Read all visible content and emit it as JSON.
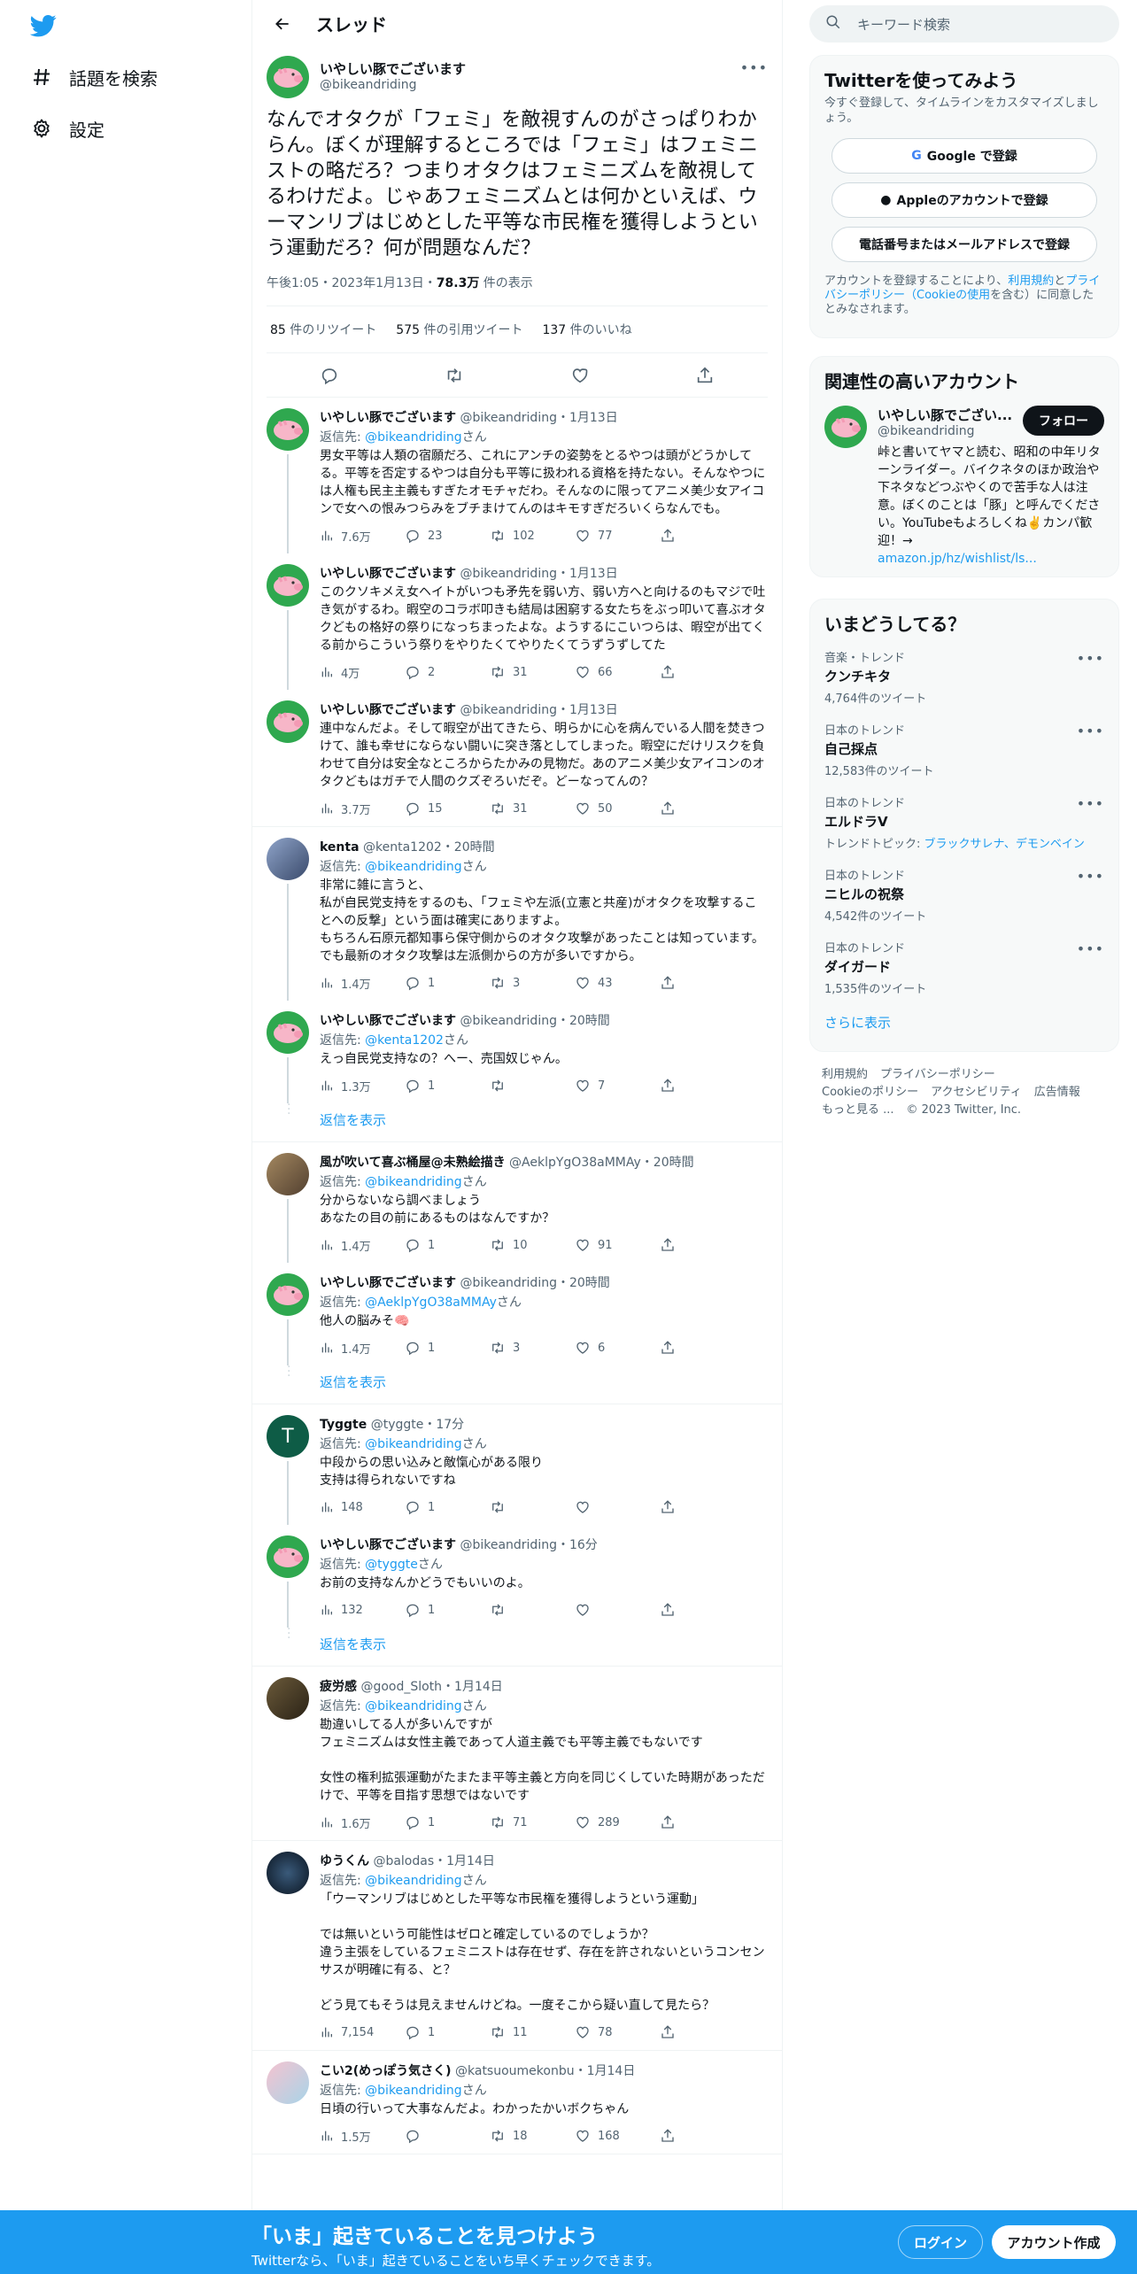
{
  "nav": {
    "explore": "話題を検索",
    "settings": "設定"
  },
  "header": {
    "title": "スレッド"
  },
  "main_tweet": {
    "name": "いやしい豚でございます",
    "handle": "@bikeandriding",
    "text": "なんでオタクが「フェミ」を敵視すんのがさっぱりわからん。ぼくが理解するところでは「フェミ」はフェミニストの略だろ？つまりオタクはフェミニズムを敵視してるわけだよ。じゃあフェミニズムとは何かといえば、ウーマンリブはじめとした平等な市民権を獲得しようという運動だろ？何が問題なんだ？",
    "time": "午後1:05・2023年1月13日・",
    "views": "78.3万",
    "views_label": " 件の表示",
    "retweets": "85",
    "retweets_label": " 件のリツイート",
    "quotes": "575",
    "quotes_label": " 件の引用ツイート",
    "likes": "137",
    "likes_label": " 件のいいね"
  },
  "replies": [
    {
      "name": "いやしい豚でございます",
      "handle": "@bikeandriding",
      "time": "・1月13日",
      "reply_to": "@bikeandriding",
      "text": "男女平等は人類の宿願だろ、これにアンチの姿勢をとるやつは頭がどうかしてる。平等を否定するやつは自分も平等に扱われる資格を持たない。そんなやつには人権も民主主義もすぎたオモチャだわ。そんなのに限ってアニメ美少女アイコンで女への恨みつらみをブチまけてんのはキモすぎだろいくらなんでも。",
      "views": "7.6万",
      "replies": "23",
      "rts": "102",
      "likes": "77"
    },
    {
      "name": "いやしい豚でございます",
      "handle": "@bikeandriding",
      "time": "・1月13日",
      "reply_to": "",
      "text": "このクソキメえ女ヘイトがいつも矛先を弱い方、弱い方へと向けるのもマジで吐き気がするわ。暇空のコラボ叩きも結局は困窮する女たちをぶっ叩いて喜ぶオタクどもの格好の祭りになっちまったよな。ようするにこいつらは、暇空が出てくる前からこういう祭りをやりたくてやりたくてうずうずしてた",
      "views": "4万",
      "replies": "2",
      "rts": "31",
      "likes": "66"
    },
    {
      "name": "いやしい豚でございます",
      "handle": "@bikeandriding",
      "time": "・1月13日",
      "reply_to": "",
      "text": "連中なんだよ。そして暇空が出てきたら、明らかに心を病んでいる人間を焚きつけて、誰も幸せにならない闘いに突き落としてしまった。暇空にだけリスクを負わせて自分は安全なところからたかみの見物だ。あのアニメ美少女アイコンのオタクどもはガチで人間のクズぞろいだぞ。どーなってんの？",
      "views": "3.7万",
      "replies": "15",
      "rts": "31",
      "likes": "50"
    },
    {
      "name": "kenta",
      "handle": "@kenta1202",
      "time": "・20時間",
      "reply_to": "@bikeandriding",
      "text": "非常に雑に言うと、\n私が自民党支持をするのも、「フェミや左派(立憲と共産)がオタクを攻撃することへの反撃」という面は確実にありますよ。\nもちろん石原元都知事ら保守側からのオタク攻撃があったことは知っています。でも最新のオタク攻撃は左派側からの方が多いですから。",
      "views": "1.4万",
      "replies": "1",
      "rts": "3",
      "likes": "43"
    },
    {
      "name": "いやしい豚でございます",
      "handle": "@bikeandriding",
      "time": "・20時間",
      "reply_to": "@kenta1202",
      "text": "えっ自民党支持なの？へー、売国奴じゃん。",
      "views": "1.3万",
      "replies": "1",
      "rts": "",
      "likes": "7"
    },
    {
      "name": "風が吹いて喜ぶ桶屋@未熟絵描き",
      "handle": "@AeklpYgO38aMMAy",
      "time": "・20時間",
      "reply_to": "@bikeandriding",
      "text": "分からないなら調べましょう\nあなたの目の前にあるものはなんですか？",
      "views": "1.4万",
      "replies": "1",
      "rts": "10",
      "likes": "91"
    },
    {
      "name": "いやしい豚でございます",
      "handle": "@bikeandriding",
      "time": "・20時間",
      "reply_to": "@AeklpYgO38aMMAy",
      "text": "他人の脳みそ🧠",
      "views": "1.4万",
      "replies": "1",
      "rts": "3",
      "likes": "6"
    },
    {
      "name": "Tyggte",
      "handle": "@tyggte",
      "time": "・17分",
      "reply_to": "@bikeandriding",
      "text": "中段からの思い込みと敵愾心がある限り\n支持は得られないですね",
      "views": "148",
      "replies": "1",
      "rts": "",
      "likes": ""
    },
    {
      "name": "いやしい豚でございます",
      "handle": "@bikeandriding",
      "time": "・16分",
      "reply_to": "@tyggte",
      "text": "お前の支持なんかどうでもいいのよ。",
      "views": "132",
      "replies": "1",
      "rts": "",
      "likes": ""
    },
    {
      "name": "疲労感",
      "handle": "@good_Sloth",
      "time": "・1月14日",
      "reply_to": "@bikeandriding",
      "text": "勘違いしてる人が多いんですが\nフェミニズムは女性主義であって人道主義でも平等主義でもないです\n\n女性の権利拡張運動がたまたま平等主義と方向を同じくしていた時期があっただけで、平等を目指す思想ではないです",
      "views": "1.6万",
      "replies": "1",
      "rts": "71",
      "likes": "289"
    },
    {
      "name": "ゆうくん",
      "handle": "@balodas",
      "time": "・1月14日",
      "reply_to": "@bikeandriding",
      "text": "「ウーマンリブはじめとした平等な市民権を獲得しようという運動」\n\nでは無いという可能性はゼロと確定しているのでしょうか？\n違う主張をしているフェミニストは存在せず、存在を許されないというコンセンサスが明確に有る、と？\n\nどう見てもそうは見えませんけどね。一度そこから疑い直して見たら？",
      "views": "7,154",
      "replies": "1",
      "rts": "11",
      "likes": "78"
    },
    {
      "name": "こい2(めっぽう気さく)",
      "handle": "@katsuoumekonbu",
      "time": "・1月14日",
      "reply_to": "@bikeandriding",
      "text": "日頃の行いって大事なんだよ。わかったかいボクちゃん",
      "views": "1.5万",
      "replies": "",
      "rts": "18",
      "likes": "168"
    }
  ],
  "show_replies": "返信を表示",
  "reply_prefix": "返信先: ",
  "reply_suffix": "さん",
  "search": {
    "placeholder": "キーワード検索"
  },
  "signup": {
    "title": "Twitterを使ってみよう",
    "subtitle": "今すぐ登録して、タイムラインをカスタマイズしましょう。",
    "google": "Google で登録",
    "apple": "Appleのアカウントで登録",
    "phone": "電話番号またはメールアドレスで登録",
    "terms_a": "アカウントを登録することにより、",
    "terms_link1": "利用規約",
    "terms_b": "と",
    "terms_link2": "プライバシーポリシー（Cookieの使用",
    "terms_c": "を含む）に同意したとみなされます。"
  },
  "related": {
    "title": "関連性の高いアカウント",
    "name": "いやしい豚でござい...",
    "handle": "@bikeandriding",
    "follow": "フォロー",
    "bio": "峠と書いてヤマと読む、昭和の中年リターンライダー。バイクネタのほか政治や下ネタなどつぶやくので苦手な人は注意。ぼくのことは「豚」と呼んでください。YouTubeもよろしくね✌️カンパ歓迎！→",
    "link": "amazon.jp/hz/wishlist/ls..."
  },
  "trends": {
    "title": "いまどうしてる？",
    "items": [
      {
        "cat": "音楽・トレンド",
        "name": "クンチキタ",
        "count": "4,764件のツイート"
      },
      {
        "cat": "日本のトレンド",
        "name": "自己採点",
        "count": "12,583件のツイート"
      },
      {
        "cat": "日本のトレンド",
        "name": "エルドラV",
        "count": "トレンドトピック: ",
        "links": "ブラックサレナ、デモンベイン"
      },
      {
        "cat": "日本のトレンド",
        "name": "ニヒルの祝祭",
        "count": "4,542件のツイート"
      },
      {
        "cat": "日本のトレンド",
        "name": "ダイガード",
        "count": "1,535件のツイート"
      }
    ],
    "more": "さらに表示"
  },
  "footer": {
    "l1": "利用規約",
    "l2": "プライバシーポリシー",
    "l3": "Cookieのポリシー",
    "l4": "アクセシビリティ",
    "l5": "広告情報",
    "l6": "もっと見る ...",
    "l7": "© 2023 Twitter, Inc."
  },
  "banner": {
    "headline": "「いま」起きていることを見つけよう",
    "sub": "Twitterなら、「いま」起きていることをいち早くチェックできます。",
    "login": "ログイン",
    "signup": "アカウント作成"
  },
  "colors": {
    "accent": "#1d9bf0",
    "pig_avatar": "#2fa84f"
  }
}
